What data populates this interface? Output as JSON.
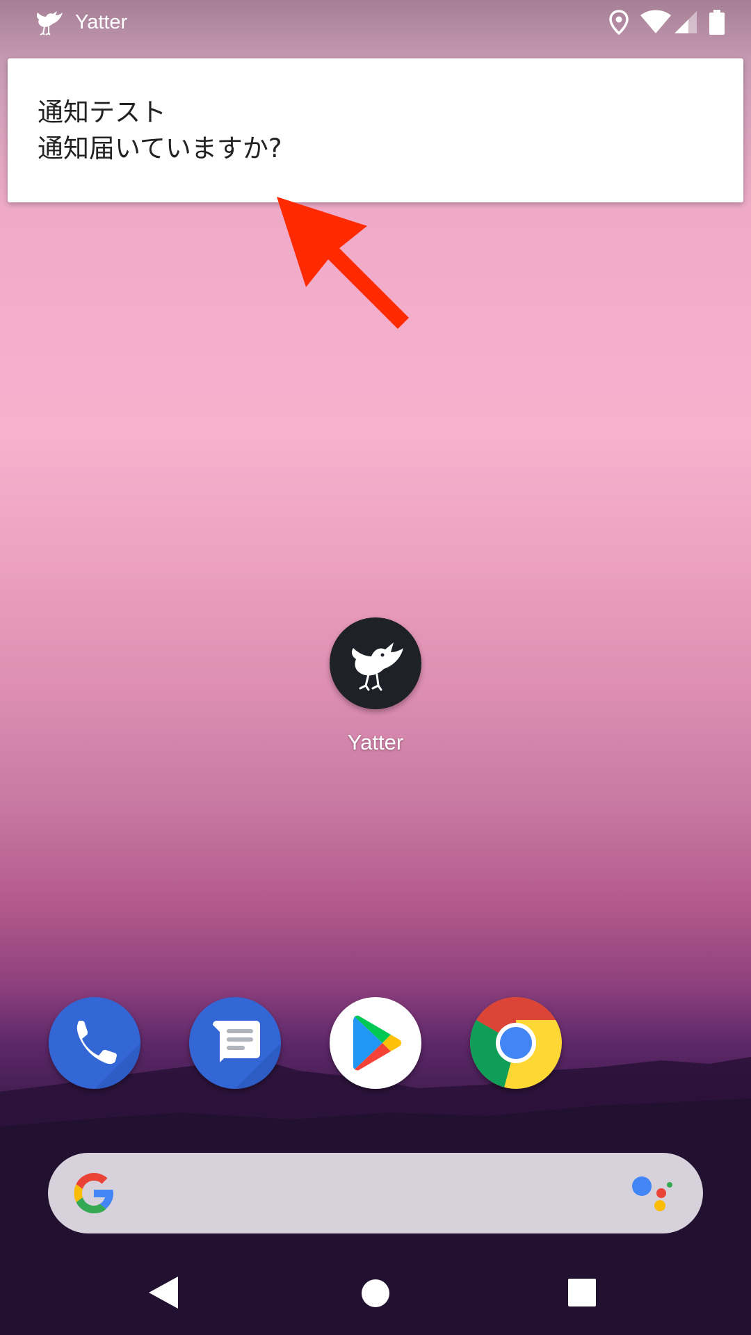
{
  "status_bar": {
    "app_name": "Yatter",
    "icons": [
      "bird-icon",
      "location-icon",
      "wifi-icon",
      "signal-icon",
      "battery-icon"
    ]
  },
  "notification": {
    "title": "通知テスト",
    "text": "通知届いていますか?"
  },
  "annotation": {
    "arrow_color": "#ff2a00"
  },
  "home": {
    "app_label": "Yatter",
    "app_icon": "bird-icon"
  },
  "dock": {
    "apps": [
      "phone-icon",
      "messages-icon",
      "play-store-icon",
      "chrome-icon"
    ]
  },
  "search_bar": {
    "icons": [
      "google-g-icon",
      "assistant-icon"
    ]
  },
  "nav_bar": {
    "buttons": [
      "back-icon",
      "home-icon",
      "recents-icon"
    ]
  },
  "colors": {
    "notification_bg": "#ffffff",
    "dock_blue": "#3367d6",
    "search_bar_bg": "#d6d1da"
  }
}
